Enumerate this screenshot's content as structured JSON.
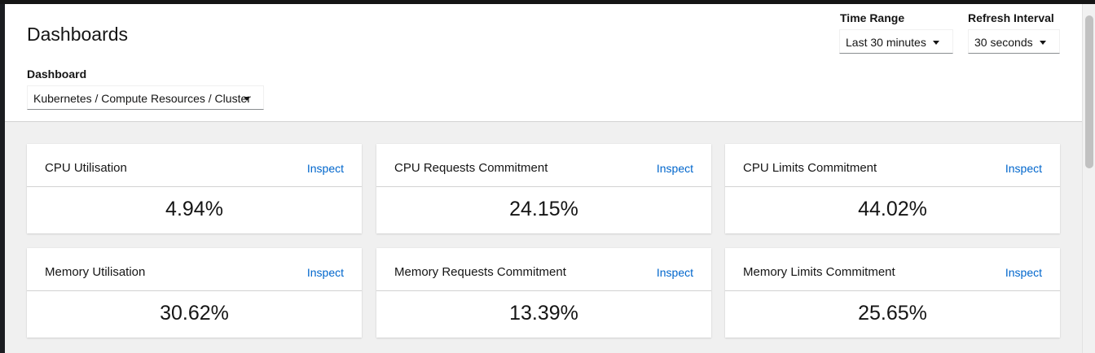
{
  "header": {
    "title": "Dashboards",
    "dashboard_label": "Dashboard",
    "dashboard_value": "Kubernetes / Compute Resources / Cluster",
    "time_range_label": "Time Range",
    "time_range_value": "Last 30 minutes",
    "refresh_label": "Refresh Interval",
    "refresh_value": "30 seconds"
  },
  "cards": [
    {
      "title": "CPU Utilisation",
      "link": "Inspect",
      "value": "4.94%"
    },
    {
      "title": "CPU Requests Commitment",
      "link": "Inspect",
      "value": "24.15%"
    },
    {
      "title": "CPU Limits Commitment",
      "link": "Inspect",
      "value": "44.02%"
    },
    {
      "title": "Memory Utilisation",
      "link": "Inspect",
      "value": "30.62%"
    },
    {
      "title": "Memory Requests Commitment",
      "link": "Inspect",
      "value": "13.39%"
    },
    {
      "title": "Memory Limits Commitment",
      "link": "Inspect",
      "value": "25.65%"
    }
  ],
  "icons": {
    "dropdown": "caret-down-icon"
  },
  "colors": {
    "link": "#0066cc",
    "page_background": "#f0f0f0",
    "card_background": "#ffffff"
  }
}
